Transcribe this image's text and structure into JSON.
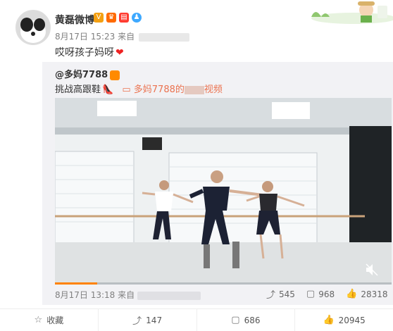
{
  "post": {
    "username": "黄磊微博",
    "meta_date": "8月17日 15:23",
    "meta_from": "来自",
    "content": "哎呀孩子妈呀",
    "heart": "❤"
  },
  "repost": {
    "username": "@多妈7788",
    "text_prefix": "挑战高跟鞋",
    "shoe": "👠",
    "link_prefix": "多妈7788的",
    "link_suffix": "视频",
    "meta_date": "8月17日 13:18",
    "meta_from": "来自",
    "stats": {
      "repost": "545",
      "comments": "968",
      "likes": "28318"
    }
  },
  "actions": {
    "collect": "收藏",
    "repost": "147",
    "comment": "686",
    "like": "20945"
  },
  "colors": {
    "accent": "#eb7350",
    "heart": "#ee2222",
    "repost_bg": "#f2f2f5"
  }
}
